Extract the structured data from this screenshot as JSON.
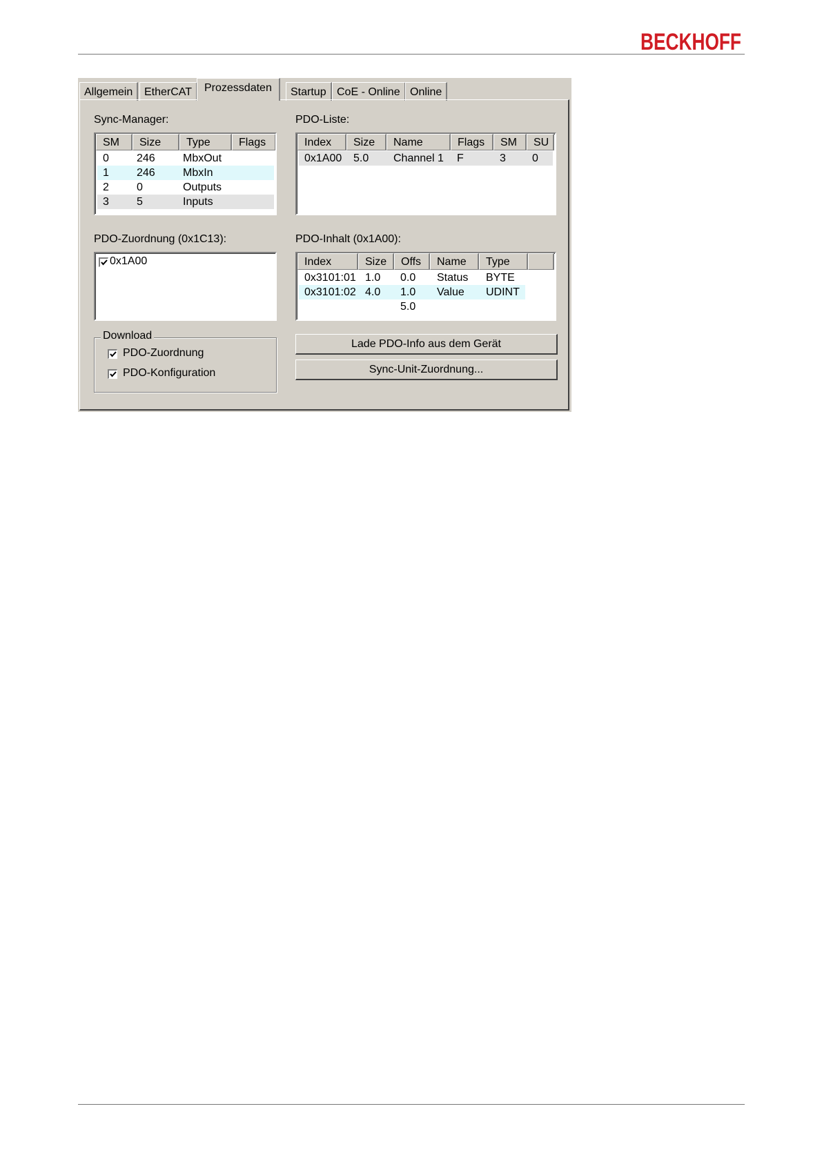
{
  "brand": {
    "logo_text": "BECKHOFF",
    "logo_color": "#d01c24"
  },
  "tabs": [
    {
      "label": "Allgemein"
    },
    {
      "label": "EtherCAT"
    },
    {
      "label": "Prozessdaten",
      "active": true
    },
    {
      "label": "Startup"
    },
    {
      "label": "CoE - Online"
    },
    {
      "label": "Online"
    }
  ],
  "sync_manager": {
    "label": "Sync-Manager:",
    "columns": [
      "SM",
      "Size",
      "Type",
      "Flags"
    ],
    "rows": [
      {
        "sm": "0",
        "size": "246",
        "type": "MbxOut",
        "flags": ""
      },
      {
        "sm": "1",
        "size": "246",
        "type": "MbxIn",
        "flags": ""
      },
      {
        "sm": "2",
        "size": "0",
        "type": "Outputs",
        "flags": ""
      },
      {
        "sm": "3",
        "size": "5",
        "type": "Inputs",
        "flags": ""
      }
    ]
  },
  "pdo_liste": {
    "label": "PDO-Liste:",
    "columns": [
      "Index",
      "Size",
      "Name",
      "Flags",
      "SM",
      "SU"
    ],
    "rows": [
      {
        "index": "0x1A00",
        "size": "5.0",
        "name": "Channel 1",
        "flags": "F",
        "sm": "3",
        "su": "0"
      }
    ]
  },
  "pdo_zuordnung": {
    "label": "PDO-Zuordnung (0x1C13):",
    "items": [
      {
        "label": "0x1A00",
        "checked": true
      }
    ]
  },
  "pdo_inhalt": {
    "label": "PDO-Inhalt (0x1A00):",
    "columns": [
      "Index",
      "Size",
      "Offs",
      "Name",
      "Type"
    ],
    "rows": [
      {
        "index": "0x3101:01",
        "size": "1.0",
        "offs": "0.0",
        "name": "Status",
        "type": "BYTE"
      },
      {
        "index": "0x3101:02",
        "size": "4.0",
        "offs": "1.0",
        "name": "Value",
        "type": "UDINT"
      },
      {
        "index": "",
        "size": "",
        "offs": "5.0",
        "name": "",
        "type": ""
      }
    ]
  },
  "download": {
    "title": "Download",
    "options": [
      {
        "label": "PDO-Zuordnung",
        "checked": true
      },
      {
        "label": "PDO-Konfiguration",
        "checked": true
      }
    ]
  },
  "buttons": {
    "lade_pdo": "Lade PDO-Info aus dem Gerät",
    "sync_unit": "Sync-Unit-Zuordnung..."
  }
}
